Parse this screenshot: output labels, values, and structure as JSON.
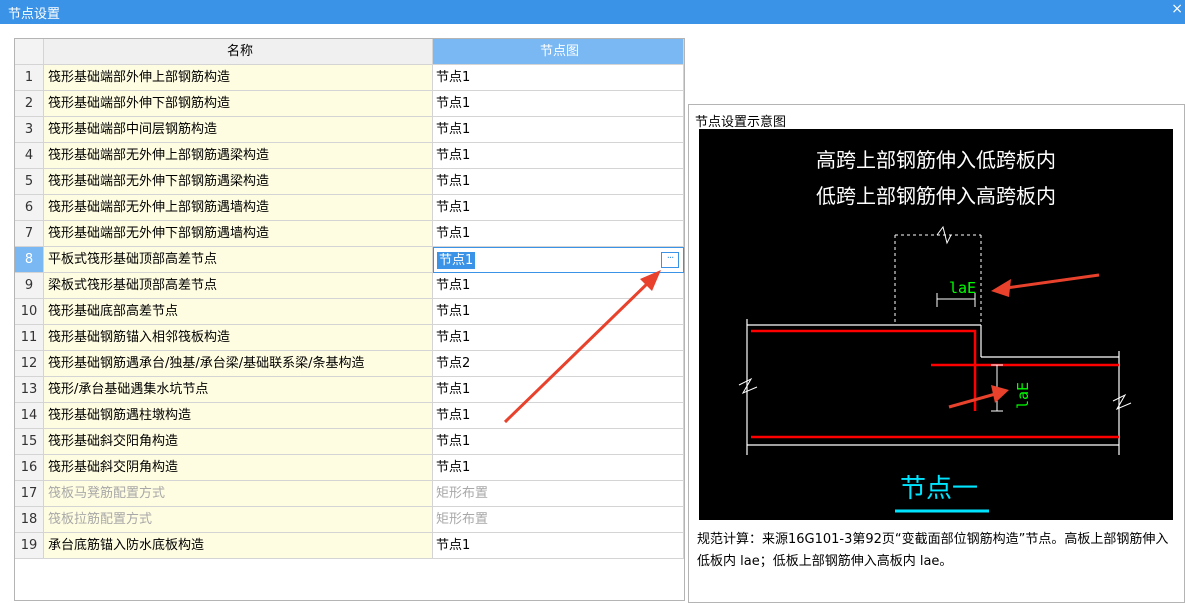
{
  "window": {
    "title": "节点设置",
    "close_glyph": "×"
  },
  "table": {
    "headers": {
      "index": "",
      "name": "名称",
      "node": "节点图"
    },
    "selected_row": 8,
    "rows": [
      {
        "idx": "1",
        "name": "筏形基础端部外伸上部钢筋构造",
        "node": "节点1",
        "disabled": false
      },
      {
        "idx": "2",
        "name": "筏形基础端部外伸下部钢筋构造",
        "node": "节点1",
        "disabled": false
      },
      {
        "idx": "3",
        "name": "筏形基础端部中间层钢筋构造",
        "node": "节点1",
        "disabled": false
      },
      {
        "idx": "4",
        "name": "筏形基础端部无外伸上部钢筋遇梁构造",
        "node": "节点1",
        "disabled": false
      },
      {
        "idx": "5",
        "name": "筏形基础端部无外伸下部钢筋遇梁构造",
        "node": "节点1",
        "disabled": false
      },
      {
        "idx": "6",
        "name": "筏形基础端部无外伸上部钢筋遇墙构造",
        "node": "节点1",
        "disabled": false
      },
      {
        "idx": "7",
        "name": "筏形基础端部无外伸下部钢筋遇墙构造",
        "node": "节点1",
        "disabled": false
      },
      {
        "idx": "8",
        "name": "平板式筏形基础顶部高差节点",
        "node": "节点1",
        "disabled": false
      },
      {
        "idx": "9",
        "name": "梁板式筏形基础顶部高差节点",
        "node": "节点1",
        "disabled": false
      },
      {
        "idx": "10",
        "name": "筏形基础底部高差节点",
        "node": "节点1",
        "disabled": false
      },
      {
        "idx": "11",
        "name": "筏形基础钢筋锚入相邻筏板构造",
        "node": "节点1",
        "disabled": false
      },
      {
        "idx": "12",
        "name": "筏形基础钢筋遇承台/独基/承台梁/基础联系梁/条基构造",
        "node": "节点2",
        "disabled": false
      },
      {
        "idx": "13",
        "name": "筏形/承台基础遇集水坑节点",
        "node": "节点1",
        "disabled": false
      },
      {
        "idx": "14",
        "name": "筏形基础钢筋遇柱墩构造",
        "node": "节点1",
        "disabled": false
      },
      {
        "idx": "15",
        "name": "筏形基础斜交阳角构造",
        "node": "节点1",
        "disabled": false
      },
      {
        "idx": "16",
        "name": "筏形基础斜交阴角构造",
        "node": "节点1",
        "disabled": false
      },
      {
        "idx": "17",
        "name": "筏板马凳筋配置方式",
        "node": "矩形布置",
        "disabled": true
      },
      {
        "idx": "18",
        "name": "筏板拉筋配置方式",
        "node": "矩形布置",
        "disabled": true
      },
      {
        "idx": "19",
        "name": "承台底筋锚入防水底板构造",
        "node": "节点1",
        "disabled": false
      }
    ],
    "ellipsis_button": "···"
  },
  "preview": {
    "title": "节点设置示意图",
    "diagram": {
      "line1": "高跨上部钢筋伸入低跨板内",
      "line2": "低跨上部钢筋伸入高跨板内",
      "dim_label_h": "laE",
      "dim_label_v": "laE",
      "caption": "节点一",
      "colors": {
        "background": "#000000",
        "rebar": "#ff0000",
        "dim": "#00ff00",
        "caption": "#00e5ff",
        "text": "#ffffff",
        "arrow": "#e8412c"
      }
    },
    "description": "规范计算：来源16G101-3第92页“变截面部位钢筋构造”节点。高板上部钢筋伸入低板内 lae；低板上部钢筋伸入高板内 lae。"
  }
}
